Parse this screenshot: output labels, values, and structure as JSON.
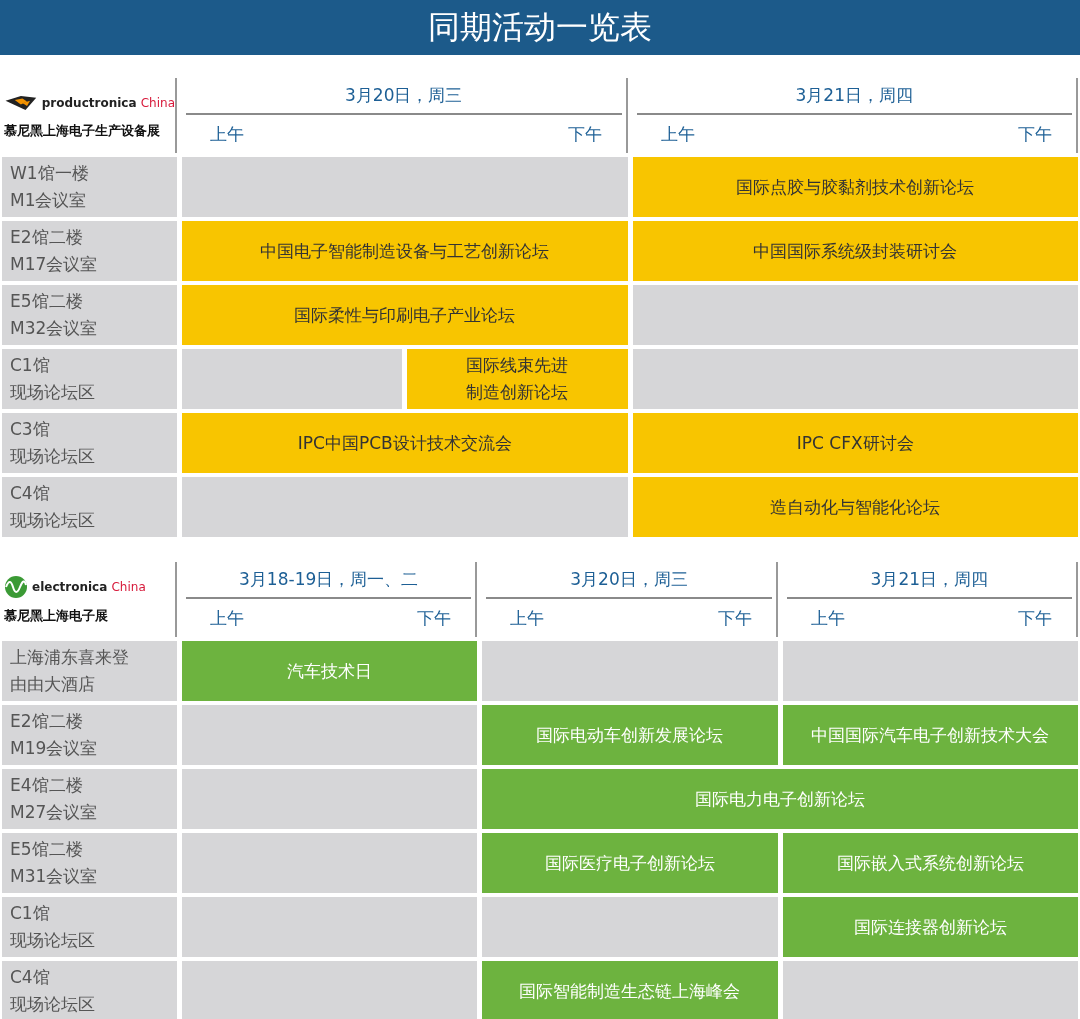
{
  "title": "同期活动一览表",
  "sections": [
    {
      "color": "#f8c500",
      "logo": {
        "brand": "productronica",
        "suffix": "China",
        "subtitle": "慕尼黑上海电子生产设备展"
      },
      "days": [
        {
          "date": "3月20日，周三",
          "am": "上午",
          "pm": "下午"
        },
        {
          "date": "3月21日，周四",
          "am": "上午",
          "pm": "下午"
        }
      ],
      "rows": [
        {
          "venue": "W1馆一楼",
          "room": "M1会议室",
          "cells": [
            {
              "kind": "blank"
            },
            {
              "kind": "event",
              "text": "国际点胶与胶黏剂技术创新论坛"
            }
          ]
        },
        {
          "venue": "E2馆二楼",
          "room": "M17会议室",
          "cells": [
            {
              "kind": "event",
              "text": "中国电子智能制造设备与工艺创新论坛"
            },
            {
              "kind": "event",
              "text": "中国国际系统级封装研讨会"
            }
          ]
        },
        {
          "venue": "E5馆二楼",
          "room": "M32会议室",
          "cells": [
            {
              "kind": "event",
              "text": "国际柔性与印刷电子产业论坛"
            },
            {
              "kind": "blank"
            }
          ]
        },
        {
          "venue": "C1馆",
          "room": "现场论坛区",
          "cells": [
            {
              "kind": "blankhalf"
            },
            {
              "kind": "eventhalf",
              "text": "国际线束先进制造创新论坛"
            },
            {
              "kind": "blank"
            }
          ]
        },
        {
          "venue": "C3馆",
          "room": "现场论坛区",
          "cells": [
            {
              "kind": "event",
              "text": "IPC中国PCB设计技术交流会"
            },
            {
              "kind": "event",
              "text": "IPC CFX研讨会"
            }
          ]
        },
        {
          "venue": "C4馆",
          "room": "现场论坛区",
          "cells": [
            {
              "kind": "blank"
            },
            {
              "kind": "event",
              "text": "造自动化与智能化论坛"
            }
          ]
        }
      ]
    },
    {
      "color": "#6db33f",
      "logo": {
        "brand": "electronica",
        "suffix": "China",
        "subtitle": "慕尼黑上海电子展"
      },
      "days": [
        {
          "date": "3月18-19日，周一、二",
          "am": "上午",
          "pm": "下午"
        },
        {
          "date": "3月20日，周三",
          "am": "上午",
          "pm": "下午"
        },
        {
          "date": "3月21日，周四",
          "am": "上午",
          "pm": "下午"
        }
      ],
      "rows": [
        {
          "venue": "上海浦东喜来登",
          "room": "由由大酒店",
          "cells": [
            {
              "kind": "event",
              "text": "汽车技术日"
            },
            {
              "kind": "blank"
            },
            {
              "kind": "blank"
            }
          ]
        },
        {
          "venue": "E2馆二楼",
          "room": "M19会议室",
          "cells": [
            {
              "kind": "blank"
            },
            {
              "kind": "event",
              "text": "国际电动车创新发展论坛"
            },
            {
              "kind": "event",
              "text": "中国国际汽车电子创新技术大会"
            }
          ]
        },
        {
          "venue": "E4馆二楼",
          "room": "M27会议室",
          "cells": [
            {
              "kind": "blank"
            },
            {
              "kind": "eventwide",
              "text": "国际电力电子创新论坛"
            }
          ]
        },
        {
          "venue": "E5馆二楼",
          "room": "M31会议室",
          "cells": [
            {
              "kind": "blank"
            },
            {
              "kind": "event",
              "text": "国际医疗电子创新论坛"
            },
            {
              "kind": "event",
              "text": "国际嵌入式系统创新论坛"
            }
          ]
        },
        {
          "venue": "C1馆",
          "room": "现场论坛区",
          "cells": [
            {
              "kind": "blank"
            },
            {
              "kind": "blank"
            },
            {
              "kind": "event",
              "text": "国际连接器创新论坛"
            }
          ]
        },
        {
          "venue": "C4馆",
          "room": "现场论坛区",
          "cells": [
            {
              "kind": "blank"
            },
            {
              "kind": "event",
              "text": "国际智能制造生态链上海峰会"
            },
            {
              "kind": "blank"
            }
          ]
        }
      ]
    }
  ]
}
